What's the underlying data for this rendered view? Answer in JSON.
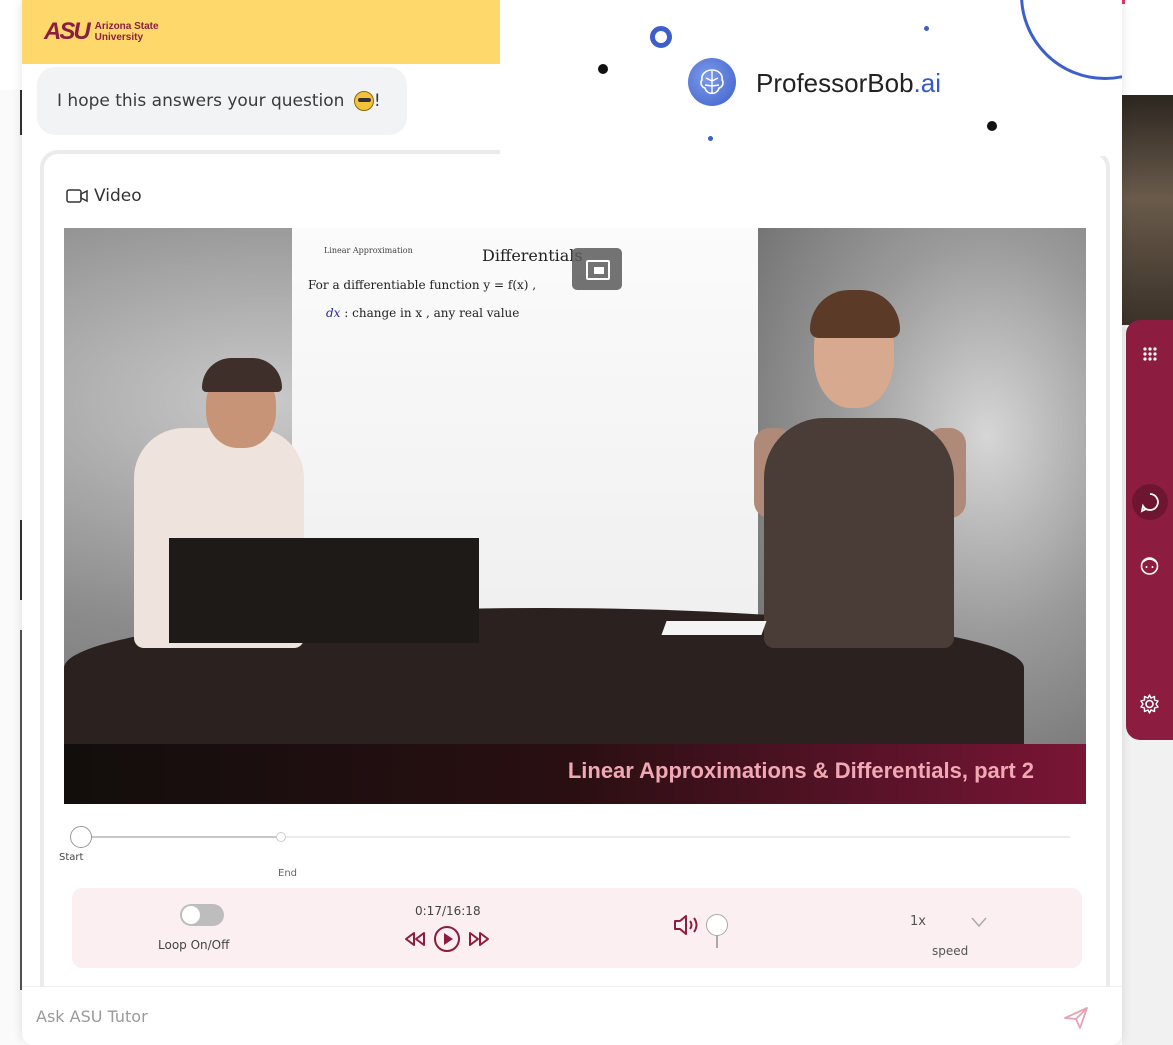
{
  "header": {
    "logo_mark": "ASU",
    "university_line1": "Arizona State",
    "university_line2": "University"
  },
  "chat": {
    "message": "I hope this answers your question",
    "message_suffix": "!"
  },
  "brand": {
    "name_prefix": "ProfessorBob",
    "name_suffix": ".ai",
    "accent": "#3d5fcc"
  },
  "video": {
    "section_label": "Video",
    "whiteboard_small": "Linear Approximation",
    "whiteboard_title": "Differentials",
    "whiteboard_line1": "For a differentiable function  y = f(x) ,",
    "whiteboard_dx": "dx",
    "whiteboard_line2": " :  change in x , any real value",
    "caption": "Linear Approximations & Differentials, part 2"
  },
  "slider": {
    "start_label": "Start",
    "end_label": "End",
    "start_position": 0.0,
    "end_position": 0.2
  },
  "controls": {
    "loop_label": "Loop On/Off",
    "loop_on": false,
    "time": "0:17/16:18",
    "speed_value": "1x",
    "speed_label": "speed"
  },
  "input": {
    "placeholder": "Ask ASU Tutor"
  },
  "colors": {
    "asu_maroon": "#8c1d40",
    "asu_gold": "#ffd86b",
    "panel_bg": "#fbeff2"
  },
  "icons": {
    "video": "video-camera-icon",
    "rewind": "rewind-icon",
    "play": "play-icon",
    "forward": "fast-forward-icon",
    "volume": "volume-icon",
    "send": "send-icon",
    "grid": "grid-icon",
    "chat": "chat-icon",
    "tutor": "face-icon",
    "settings": "gear-icon"
  }
}
